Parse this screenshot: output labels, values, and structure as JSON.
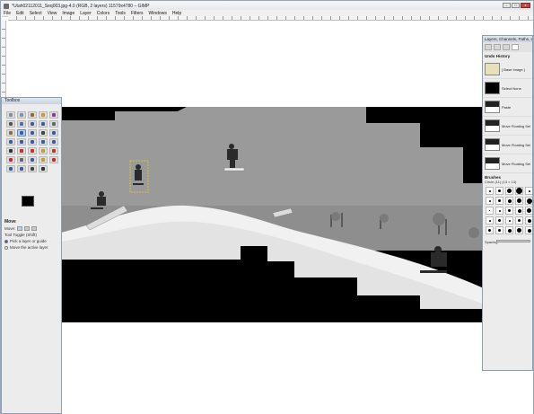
{
  "window": {
    "title": "*Utah02112011_Seq003.jpg-4.0 (RGB, 2 layers) 11579x4780 – GIMP",
    "buttons": {
      "minimize": "–",
      "maximize": "□",
      "close": "x"
    }
  },
  "menubar": {
    "items": [
      "File",
      "Edit",
      "Select",
      "View",
      "Image",
      "Layer",
      "Colors",
      "Tools",
      "Filters",
      "Windows",
      "Help"
    ]
  },
  "toolbox": {
    "title": "Toolbox",
    "tools": [
      {
        "icon": "rect-select-icon",
        "color": "#7f8fa6"
      },
      {
        "icon": "ellipse-select-icon",
        "color": "#7f8fa6"
      },
      {
        "icon": "free-select-icon",
        "color": "#8a6c3c"
      },
      {
        "icon": "fuzzy-select-icon",
        "color": "#c79a2e"
      },
      {
        "icon": "select-by-color-icon",
        "color": "#8c3a8c"
      },
      {
        "icon": "scissors-select-icon",
        "color": "#555555"
      },
      {
        "icon": "foreground-select-icon",
        "color": "#4a6ea8"
      },
      {
        "icon": "paths-icon",
        "color": "#3a5e9e"
      },
      {
        "icon": "color-picker-icon",
        "color": "#3a5e9e"
      },
      {
        "icon": "zoom-icon",
        "color": "#666666"
      },
      {
        "icon": "measure-icon",
        "color": "#8a6c3c"
      },
      {
        "icon": "move-icon",
        "color": "#3a5e9e",
        "active": true
      },
      {
        "icon": "align-icon",
        "color": "#3a5e9e"
      },
      {
        "icon": "crop-icon",
        "color": "#444444"
      },
      {
        "icon": "rotate-icon",
        "color": "#3a5e9e"
      },
      {
        "icon": "scale-icon",
        "color": "#3a5e9e"
      },
      {
        "icon": "shear-icon",
        "color": "#3a5e9e"
      },
      {
        "icon": "perspective-icon",
        "color": "#3a5e9e"
      },
      {
        "icon": "flip-icon",
        "color": "#3a5e9e"
      },
      {
        "icon": "cage-icon",
        "color": "#3a5e9e"
      },
      {
        "icon": "text-icon",
        "color": "#333333"
      },
      {
        "icon": "bucket-fill-icon",
        "color": "#c2302a"
      },
      {
        "icon": "blend-icon",
        "color": "#c2302a"
      },
      {
        "icon": "pencil-icon",
        "color": "#c79a2e"
      },
      {
        "icon": "paintbrush-icon",
        "color": "#c2302a"
      },
      {
        "icon": "eraser-icon",
        "color": "#c2302a"
      },
      {
        "icon": "airbrush-icon",
        "color": "#666666"
      },
      {
        "icon": "ink-icon",
        "color": "#3a5e9e"
      },
      {
        "icon": "clone-icon",
        "color": "#c79a2e"
      },
      {
        "icon": "heal-icon",
        "color": "#c2302a"
      },
      {
        "icon": "perspective-clone-icon",
        "color": "#3a5e9e"
      },
      {
        "icon": "blur-icon",
        "color": "#3a5e9e"
      },
      {
        "icon": "smudge-icon",
        "color": "#444444"
      },
      {
        "icon": "dodge-burn-icon",
        "color": "#333333"
      }
    ],
    "options": {
      "title": "Move",
      "move_label": "Move:",
      "toggle_label": "Tool Toggle  (Shift)",
      "radio_1": "Pick a layer or guide",
      "radio_2": "Move the active layer"
    }
  },
  "dock": {
    "title": "Layers, Channels, Paths, Undo",
    "undo_title": "Undo History",
    "history": [
      {
        "label": "[ Base Image ]",
        "thumb": "base"
      },
      {
        "label": "Select None",
        "thumb": "black"
      },
      {
        "label": "Paste",
        "thumb": "scene"
      },
      {
        "label": "Move Floating Sel",
        "thumb": "scene"
      },
      {
        "label": "Move Floating Sel",
        "thumb": "scene"
      },
      {
        "label": "Move Floating Sel",
        "thumb": "scene"
      }
    ],
    "brushes_title": "Brushes",
    "brush_name": "Circle (11) (13 × 13)",
    "brush_sizes": [
      2,
      3,
      5,
      7,
      2,
      2,
      3,
      4,
      5,
      6,
      1,
      2,
      3,
      4,
      5,
      2,
      3,
      2,
      3,
      4,
      3,
      3,
      4,
      5,
      4
    ],
    "spacing_label": "Spacing"
  }
}
